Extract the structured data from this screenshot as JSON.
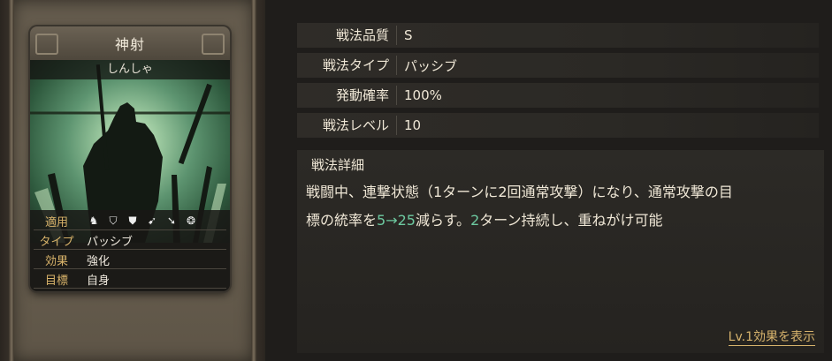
{
  "card": {
    "name": "神射",
    "reading": "しんしゃ",
    "stats": [
      {
        "key": "適用",
        "value": ""
      },
      {
        "key": "タイプ",
        "value": "パッシブ"
      },
      {
        "key": "効果",
        "value": "強化"
      },
      {
        "key": "目標",
        "value": "自身"
      }
    ],
    "applicable_icons": [
      "cavalry-icon",
      "shield-icon",
      "shield-icon",
      "bow-icon",
      "spear-icon",
      "wheel-icon"
    ]
  },
  "info": {
    "rows": [
      {
        "label": "戦法品質",
        "value": "S"
      },
      {
        "label": "戦法タイプ",
        "value": "パッシブ"
      },
      {
        "label": "発動確率",
        "value": "100%"
      },
      {
        "label": "戦法レベル",
        "value": "10"
      }
    ],
    "detail_title": "戦法詳細",
    "detail_line1": "戦闘中、連撃状態（1ターンに2回通常攻撃）になり、通常攻撃の目",
    "detail_line2_a": "標の統率を",
    "detail_line2_num": "5→25",
    "detail_line2_b": "減らす。",
    "detail_line2_num2": "2",
    "detail_line2_c": "ターン持続し、重ねがけ可能",
    "level_link": "Lv.1効果を表示"
  },
  "colors": {
    "highlight": "#6dc9a0",
    "gold": "#d7b36c"
  }
}
